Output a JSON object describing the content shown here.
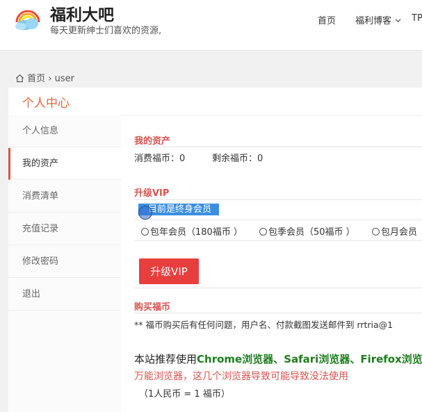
{
  "header": {
    "site_title": "福利大吧",
    "site_subtitle": "每天更新绅士们喜欢的资源,",
    "logo_icon": "rainbow-cloud-icon",
    "nav": [
      {
        "label": "首页"
      },
      {
        "label": "福利博客"
      },
      {
        "label": "TP"
      }
    ],
    "dropdown_icon": "chevron-down-icon"
  },
  "breadcrumb": {
    "home_icon": "home-icon",
    "home_label": "首页",
    "separator": "›",
    "current": "user"
  },
  "panel": {
    "title": "个人中心",
    "title_color": "#e4623d"
  },
  "sidebar": {
    "items": [
      {
        "label": "个人信息",
        "active": false
      },
      {
        "label": "我的资产",
        "active": true
      },
      {
        "label": "消费清单",
        "active": false
      },
      {
        "label": "充值记录",
        "active": false
      },
      {
        "label": "修改密码",
        "active": false
      },
      {
        "label": "退出",
        "active": false
      }
    ],
    "active_color": "#d9534f"
  },
  "assets": {
    "heading": "我的资产",
    "spent_label": "消费福币：0",
    "remaining_label": "剩余福币：0"
  },
  "vip": {
    "heading": "升级VIP",
    "status_text": "目前是终身会员",
    "options": [
      "包年会员（180福币 ）",
      "包季会员（50福币 ）",
      "包月会员"
    ],
    "button_label": "升级VIP",
    "button_color": "#e83e3e"
  },
  "buy": {
    "heading": "购买福币",
    "note": "** 福币购买后有任何问题，用户名、付款截图发送邮件到 rrtria@1"
  },
  "recommend": {
    "prefix": "本站推荐使用",
    "browsers": "Chrome浏览器、Safari浏览器、Firefox浏览",
    "warning": "万能浏览器，这几个浏览器导致可能导致没法使用",
    "rate": "（1人民币 = 1 福币）"
  }
}
